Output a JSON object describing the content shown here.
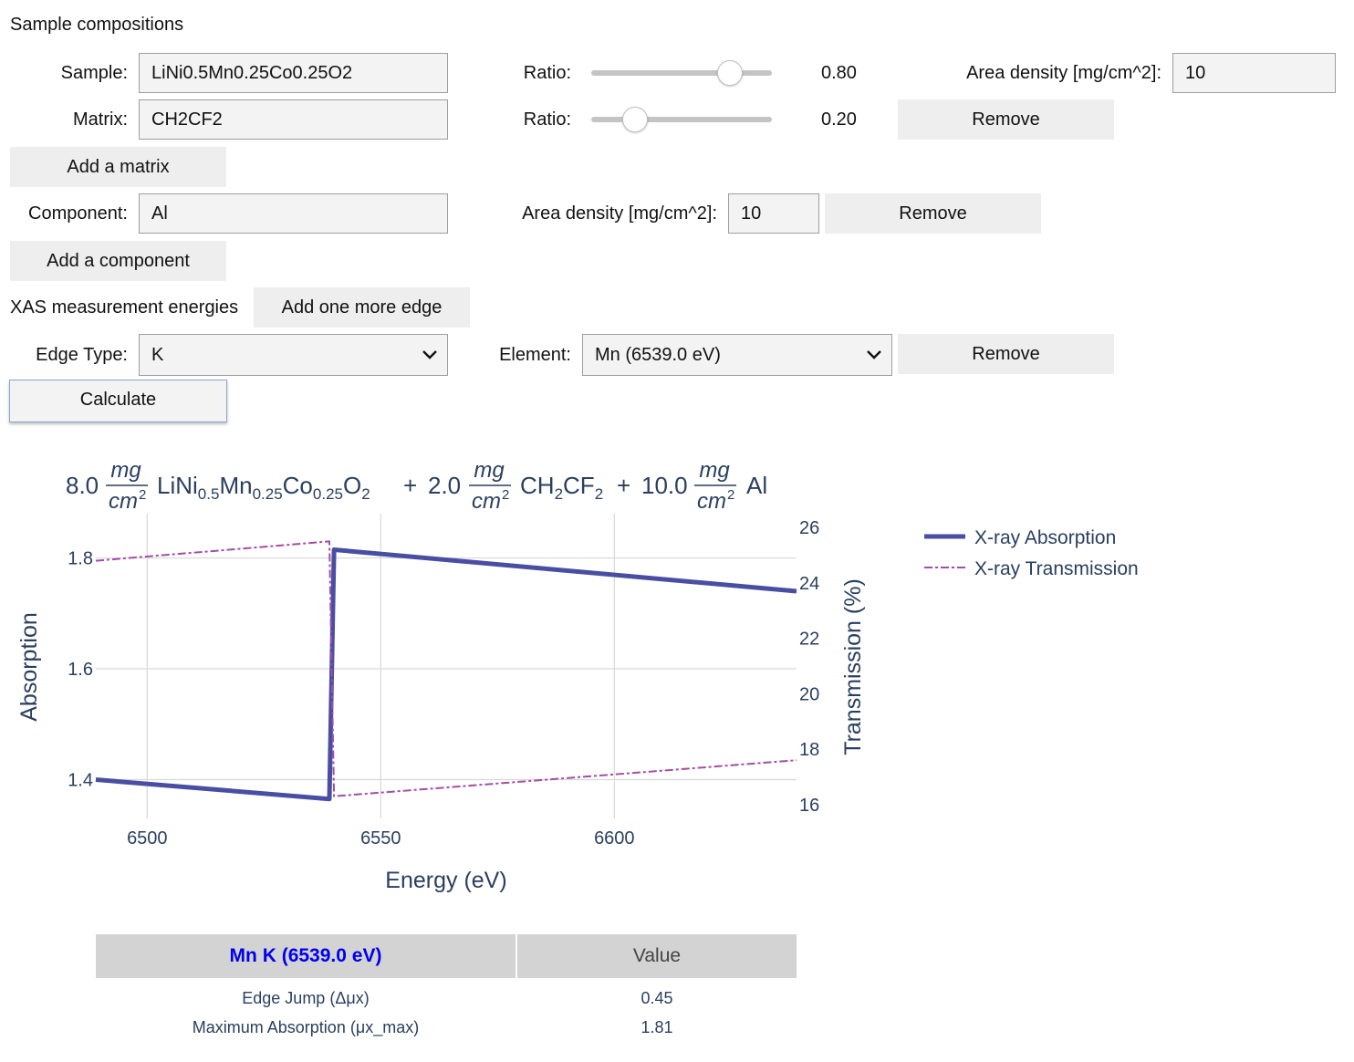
{
  "form": {
    "section_title": "Sample compositions",
    "sample_label": "Sample:",
    "sample_value": "LiNi0.5Mn0.25Co0.25O2",
    "ratio_label": "Ratio:",
    "sample_ratio": 0.8,
    "sample_ratio_text": "0.80",
    "area_density_label": "Area density [mg/cm^2]:",
    "sample_area_density": "10",
    "matrix_label": "Matrix:",
    "matrix_value": "CH2CF2",
    "matrix_ratio": 0.2,
    "matrix_ratio_text": "0.20",
    "remove_label": "Remove",
    "add_matrix_label": "Add a matrix",
    "component_label": "Component:",
    "component_value": "Al",
    "component_area_density": "10",
    "add_component_label": "Add a component",
    "xas_label": "XAS measurement energies",
    "add_edge_label": "Add one more edge",
    "edge_type_label": "Edge Type:",
    "edge_type_value": "K",
    "element_label": "Element:",
    "element_value": "Mn (6539.0 eV)",
    "calculate_label": "Calculate"
  },
  "chart_data": {
    "type": "line",
    "title_parts": {
      "c1": "8.0",
      "c2": "2.0",
      "c3": "10.0",
      "unit_num": "mg",
      "unit_den": "cm",
      "plus": "+",
      "comp3": "Al"
    },
    "xlabel": "Energy (eV)",
    "ylabel": "Absorption",
    "y2label": "Transmission (%)",
    "xlim": [
      6489,
      6639
    ],
    "ylim": [
      1.33,
      1.88
    ],
    "y2lim": [
      15.5,
      26.5
    ],
    "x_ticks": [
      6500,
      6550,
      6600
    ],
    "y_ticks": [
      1.4,
      1.6,
      1.8
    ],
    "y2_ticks": [
      16,
      18,
      20,
      22,
      24,
      26
    ],
    "series": [
      {
        "name": "X-ray Absorption",
        "axis": "y",
        "color": "#4a4ea3",
        "style": "solid",
        "x": [
          6489,
          6539,
          6540,
          6639
        ],
        "y": [
          1.4,
          1.365,
          1.815,
          1.74
        ]
      },
      {
        "name": "X-ray Transmission",
        "axis": "y2",
        "color": "#a24ea3",
        "style": "dashdot",
        "x": [
          6489,
          6539,
          6540,
          6639
        ],
        "y": [
          24.8,
          25.5,
          16.3,
          17.6
        ]
      }
    ]
  },
  "table": {
    "header_edge": "Mn K (6539.0 eV)",
    "header_value": "Value",
    "rows": [
      {
        "label": "Edge Jump (Δμx)",
        "value": "0.45"
      },
      {
        "label": "Maximum Absorption (μx_max)",
        "value": "1.81"
      }
    ]
  }
}
